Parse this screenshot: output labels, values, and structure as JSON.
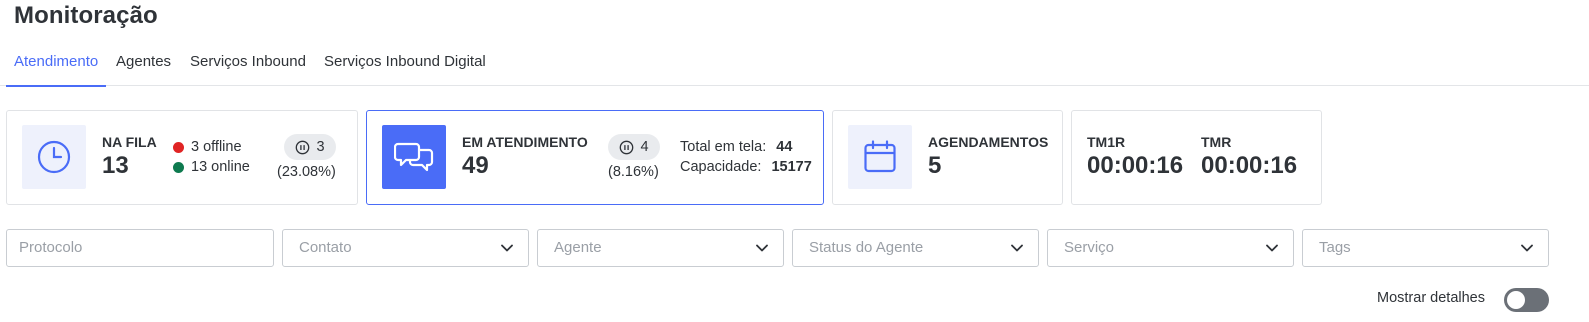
{
  "page": {
    "title": "Monitoração"
  },
  "tabs": [
    {
      "label": "Atendimento",
      "active": true
    },
    {
      "label": "Agentes",
      "active": false
    },
    {
      "label": "Serviços Inbound",
      "active": false
    },
    {
      "label": "Serviços Inbound Digital",
      "active": false
    }
  ],
  "cards": {
    "na_fila": {
      "label": "NA FILA",
      "value": "13",
      "offline": "3 offline",
      "online": "13 online",
      "paused": "3",
      "paused_pct": "(23.08%)",
      "icon": "clock-icon"
    },
    "em_atendimento": {
      "label": "EM ATENDIMENTO",
      "value": "49",
      "paused": "4",
      "paused_pct": "(8.16%)",
      "total_label": "Total em tela:",
      "total_value": "44",
      "capacity_label": "Capacidade:",
      "capacity_value": "15177",
      "icon": "chat-bubbles-icon"
    },
    "agendamentos": {
      "label": "AGENDAMENTOS",
      "value": "5",
      "icon": "calendar-icon"
    },
    "tempos": {
      "tm1r_label": "TM1R",
      "tm1r_value": "00:00:16",
      "tmr_label": "TMR",
      "tmr_value": "00:00:16"
    }
  },
  "filters": {
    "protocolo": "Protocolo",
    "contato": "Contato",
    "agente": "Agente",
    "status_agente": "Status do Agente",
    "servico": "Serviço",
    "tags": "Tags"
  },
  "details_toggle": {
    "label": "Mostrar detalhes",
    "on": false
  },
  "colors": {
    "accent": "#4a6cf7",
    "offline": "#e02424",
    "online": "#0e7a4f"
  }
}
